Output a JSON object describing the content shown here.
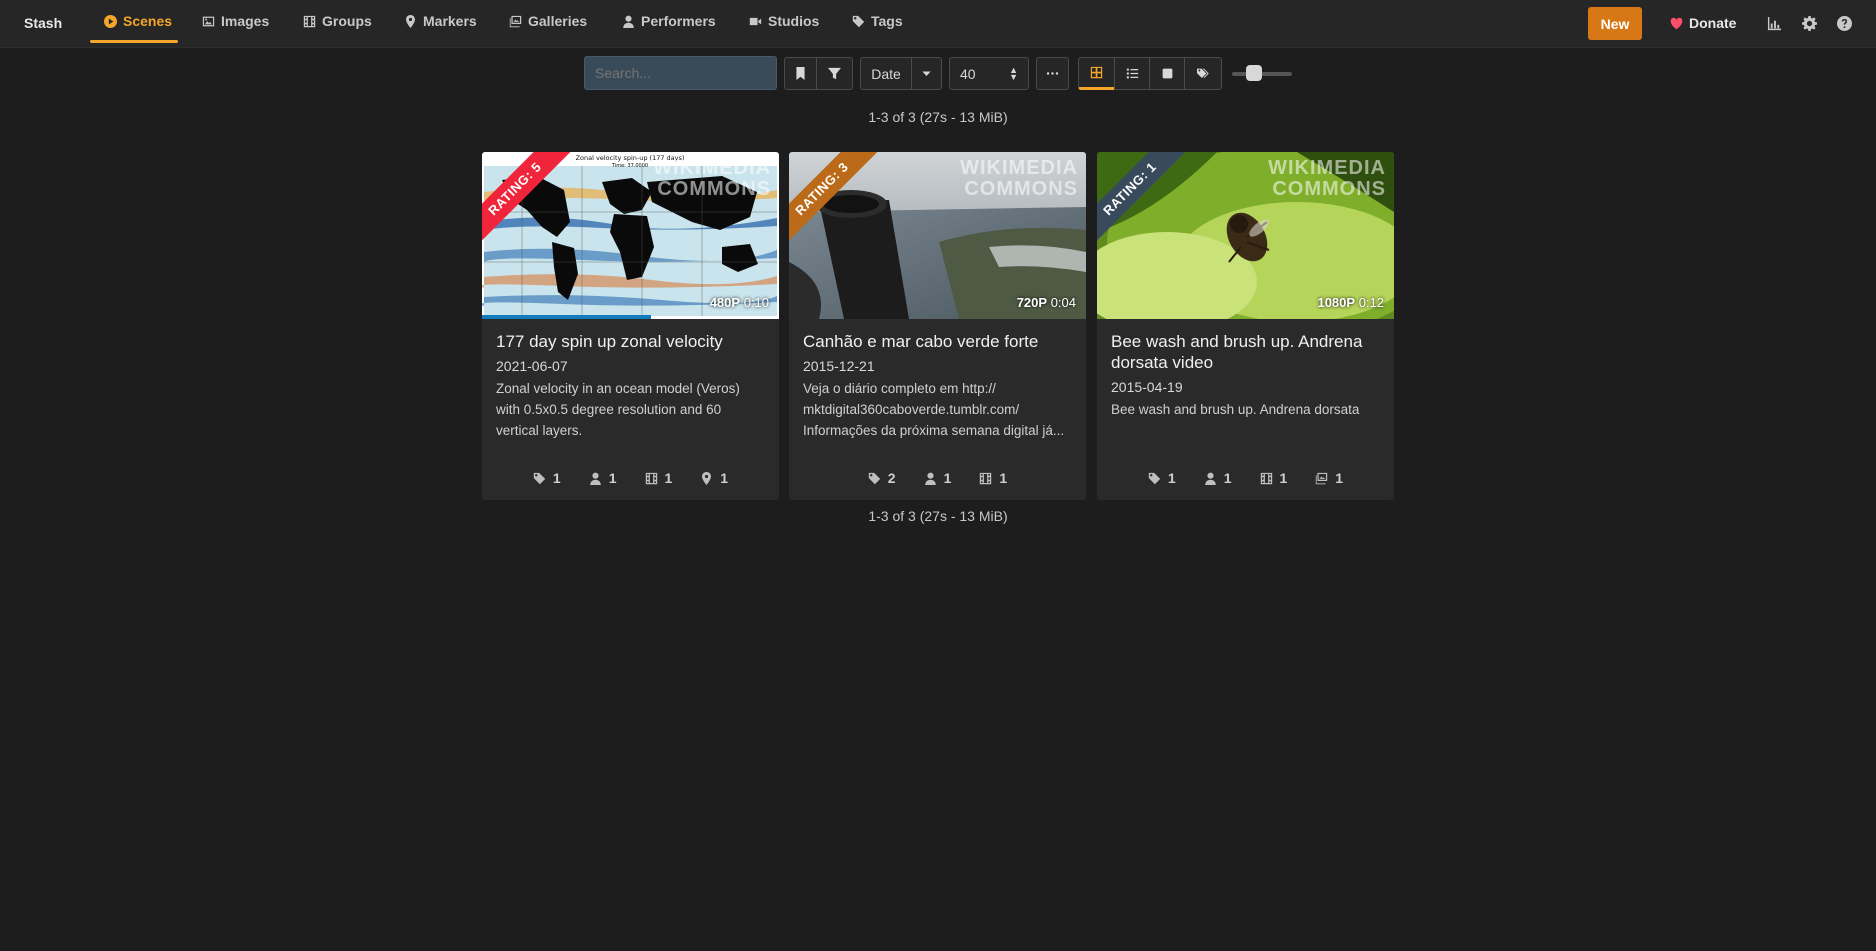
{
  "nav": {
    "brand": "Stash",
    "items": [
      {
        "label": "Scenes",
        "icon": "play-circle-icon",
        "active": true
      },
      {
        "label": "Images",
        "icon": "image-icon"
      },
      {
        "label": "Groups",
        "icon": "film-icon"
      },
      {
        "label": "Markers",
        "icon": "map-marker-icon"
      },
      {
        "label": "Galleries",
        "icon": "images-icon"
      },
      {
        "label": "Performers",
        "icon": "user-icon"
      },
      {
        "label": "Studios",
        "icon": "video-icon"
      },
      {
        "label": "Tags",
        "icon": "tag-icon"
      }
    ],
    "new_label": "New",
    "donate_label": "Donate"
  },
  "toolbar": {
    "search_placeholder": "Search...",
    "sort_label": "Date",
    "per_page": "40"
  },
  "summary": "1-3 of 3 (27s - 13 MiB)",
  "colors": {
    "accent": "#f4a62a",
    "new_button": "#d87716",
    "rating5": "#f0243a",
    "rating3": "#bb6a1a",
    "rating1": "#384a5c",
    "progress": "#137cbd"
  },
  "cards": [
    {
      "title": "177 day spin up zonal velocity",
      "date": "2021-06-07",
      "description": "Zonal velocity in an ocean model (Veros) with 0.5x0.5 degree resolution and 60 vertical layers.",
      "rating": "RATING: 5",
      "resolution": "480P",
      "duration": "0:10",
      "watermark_line1": "WIKIMEDIA",
      "watermark_line2": "COMMONS",
      "thumb_caption": "Zonal velocity spin-up (177 days)",
      "thumb_time": "Time: 37.0000",
      "progress_fraction": 0.57,
      "stats": [
        {
          "icon": "tag-icon",
          "value": "1"
        },
        {
          "icon": "user-icon",
          "value": "1"
        },
        {
          "icon": "film-icon",
          "value": "1"
        },
        {
          "icon": "map-marker-icon",
          "value": "1"
        }
      ]
    },
    {
      "title": "Canhão e mar cabo verde forte",
      "date": "2015-12-21",
      "description": "Veja o diário completo em http:// mktdigital360caboverde.tumblr.com/ Informações da próxima semana digital já...",
      "rating": "RATING: 3",
      "resolution": "720P",
      "duration": "0:04",
      "watermark_line1": "WIKIMEDIA",
      "watermark_line2": "COMMONS",
      "stats": [
        {
          "icon": "tag-icon",
          "value": "2"
        },
        {
          "icon": "user-icon",
          "value": "1"
        },
        {
          "icon": "film-icon",
          "value": "1"
        }
      ]
    },
    {
      "title": "Bee wash and brush up. Andrena dorsata video",
      "date": "2015-04-19",
      "description": "Bee wash and brush up. Andrena dorsata",
      "rating": "RATING: 1",
      "resolution": "1080P",
      "duration": "0:12",
      "watermark_line1": "WIKIMEDIA",
      "watermark_line2": "COMMONS",
      "stats": [
        {
          "icon": "tag-icon",
          "value": "1"
        },
        {
          "icon": "user-icon",
          "value": "1"
        },
        {
          "icon": "film-icon",
          "value": "1"
        },
        {
          "icon": "images-icon",
          "value": "1"
        }
      ]
    }
  ]
}
